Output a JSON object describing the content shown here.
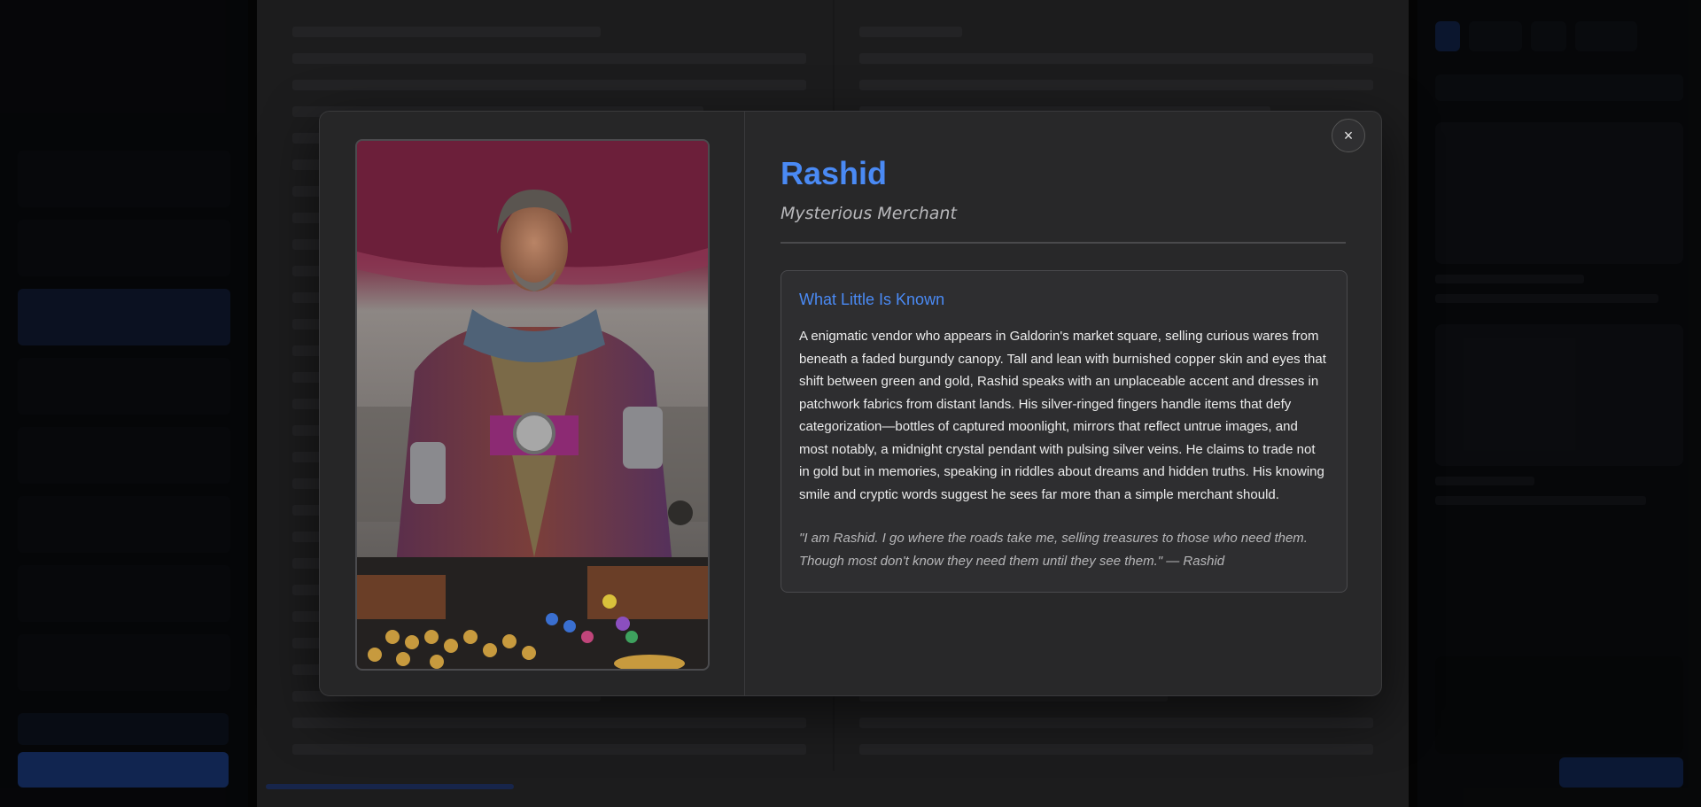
{
  "character": {
    "name": "Rashid",
    "role": "Mysterious Merchant",
    "section_title": "What Little Is Known",
    "description": "A enigmatic vendor who appears in Galdorin's market square, selling curious wares from beneath a faded burgundy canopy. Tall and lean with burnished copper skin and eyes that shift between green and gold, Rashid speaks with an unplaceable accent and dresses in patchwork fabrics from distant lands. His silver-ringed fingers handle items that defy categorization—bottles of captured moonlight, mirrors that reflect untrue images, and most notably, a midnight crystal pendant with pulsing silver veins. He claims to trade not in gold but in memories, speaking in riddles about dreams and hidden truths. His knowing smile and cryptic words suggest he sees far more than a simple merchant should.",
    "quote": "\"I am Rashid. I go where the roads take me, selling treasures to those who need them. Though most don't know they need them until they see them.\" — Rashid"
  },
  "modal": {
    "close_label": "×"
  },
  "portrait": {
    "icon": "merchant-portrait"
  },
  "colors": {
    "accent": "#4a8af4",
    "modal_bg": "#282829",
    "overlay": "rgba(0,0,0,0.62)"
  }
}
